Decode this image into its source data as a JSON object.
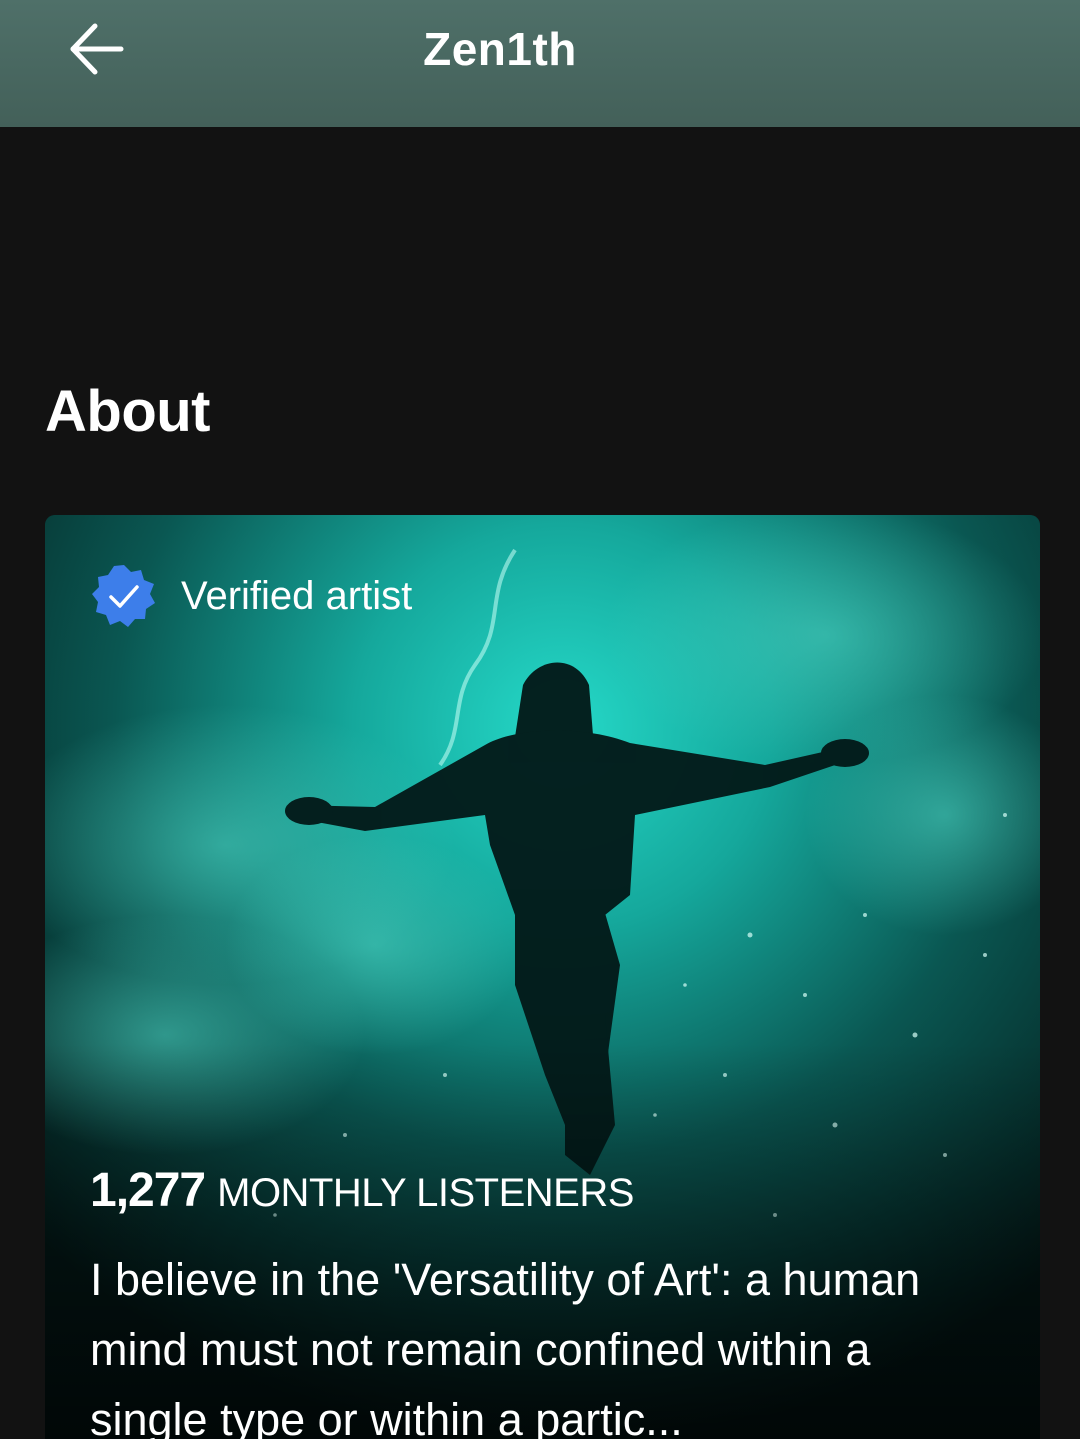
{
  "header": {
    "title": "Zen1th",
    "back_icon": "arrow-left-icon"
  },
  "about": {
    "heading": "About",
    "verified_label": "Verified artist",
    "verified_icon": "verified-badge-icon",
    "monthly_listeners_count": "1,277",
    "monthly_listeners_label": "MONTHLY LISTENERS",
    "bio": "I believe in the 'Versatility of Art': a human mind must not remain confined within a single type or within a partic..."
  },
  "colors": {
    "header_bg": "#4b6a63",
    "page_bg": "#121212",
    "verified_blue": "#3d7eea",
    "artwork_accent": "#1fd1c2"
  }
}
